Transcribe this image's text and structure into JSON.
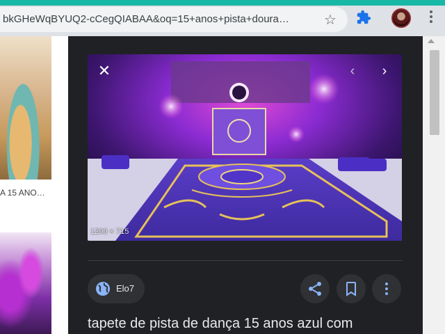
{
  "browser": {
    "url": "bkGHeWqBYUQ2-cCegQIABAA&oq=15+anos+pista+doura…",
    "bookmark_icon": "star-icon",
    "extension_icon": "puzzle-icon",
    "menu_icon": "kebab-menu-icon"
  },
  "results": {
    "thumb_caption": "A 15 ANO…"
  },
  "preview": {
    "dimensions": "1200 × 715",
    "close_icon": "close-icon",
    "prev_icon": "chevron-left-icon",
    "next_icon": "chevron-right-icon"
  },
  "source": {
    "name": "Elo7",
    "icon": "globe-icon"
  },
  "actions": {
    "share_icon": "share-icon",
    "save_icon": "bookmark-icon",
    "more_icon": "more-vert-icon"
  },
  "image_title": "tapete de pista de dança 15 anos azul com",
  "colors": {
    "panel_bg": "#202124",
    "chip_bg": "#303134",
    "accent_blue": "#8ab4f8",
    "tab_teal": "#17b8a6"
  }
}
